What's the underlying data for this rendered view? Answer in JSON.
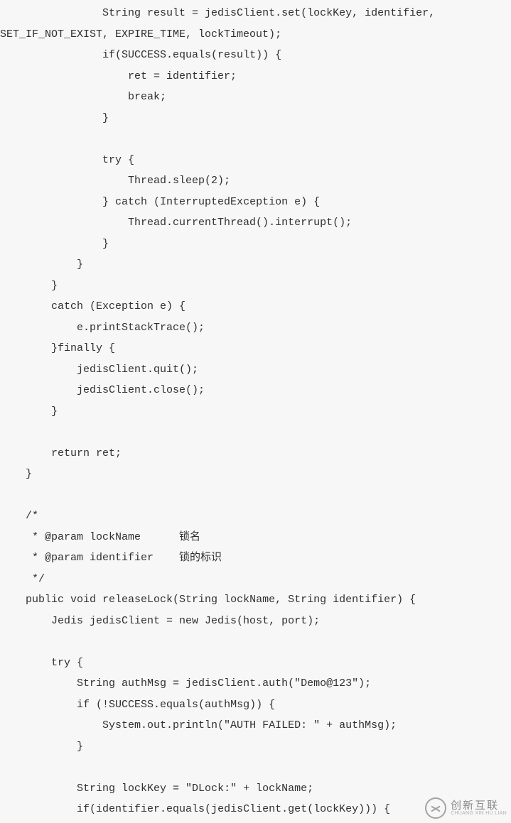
{
  "code": "                String result = jedisClient.set(lockKey, identifier, SET_IF_NOT_EXIST, EXPIRE_TIME, lockTimeout);\n                if(SUCCESS.equals(result)) {\n                    ret = identifier;\n                    break;\n                }\n\n                try {\n                    Thread.sleep(2);\n                } catch (InterruptedException e) {\n                    Thread.currentThread().interrupt();\n                }\n            }\n        }\n        catch (Exception e) {\n            e.printStackTrace();\n        }finally {\n            jedisClient.quit();\n            jedisClient.close();\n        }\n\n        return ret;\n    }\n\n    /*\n     * @param lockName      锁名\n     * @param identifier    锁的标识\n     */\n    public void releaseLock(String lockName, String identifier) {\n        Jedis jedisClient = new Jedis(host, port);\n\n        try {\n            String authMsg = jedisClient.auth(\"Demo@123\");\n            if (!SUCCESS.equals(authMsg)) {\n                System.out.println(\"AUTH FAILED: \" + authMsg);\n            }\n\n            String lockKey = \"DLock:\" + lockName;\n            if(identifier.equals(jedisClient.get(lockKey))) {",
  "watermark": {
    "cn": "创新互联",
    "py": "CHUANG XIN HU LIAN"
  }
}
